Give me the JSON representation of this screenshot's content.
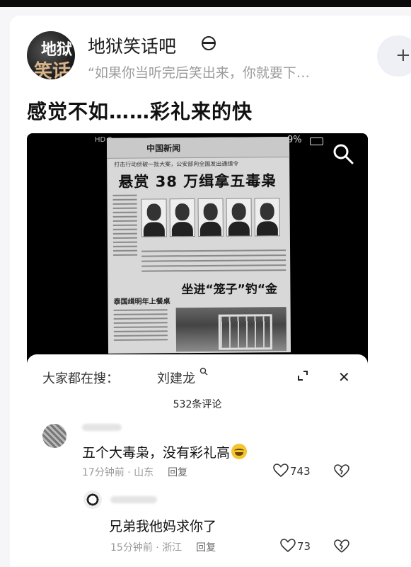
{
  "group": {
    "avatar_line1": "地狱",
    "avatar_line2": "笑话",
    "name": "地狱笑话吧",
    "quote": "“如果你当听完后笑出来，你就要下…",
    "follow_label": "+"
  },
  "post": {
    "title": "感觉不如……彩礼来的快"
  },
  "media": {
    "status_left": "HD 2",
    "status_right": "9%",
    "newspaper_name": "中国新闻",
    "newspaper_subhead": "打击行动侦破一批大案，公安部向全国发出通缉令",
    "newspaper_headline": "悬赏 38 万缉拿五毒枭",
    "newspaper_side_head": "泰国缉明年上餐桌",
    "newspaper_headline2": "坐进“笼子”钓“金"
  },
  "comments": {
    "trending_label": "大家都在搜：",
    "trending_term": "刘建龙",
    "count_label": "532条评论",
    "items": [
      {
        "text": "五个大毒枭，没有彩礼高",
        "time_location": "17分钟前 · 山东",
        "reply_label": "回复",
        "likes": "743"
      },
      {
        "text": "兄弟我他妈求你了",
        "time_location": "15分钟前 · 浙江",
        "reply_label": "回复",
        "likes": "73"
      }
    ]
  }
}
